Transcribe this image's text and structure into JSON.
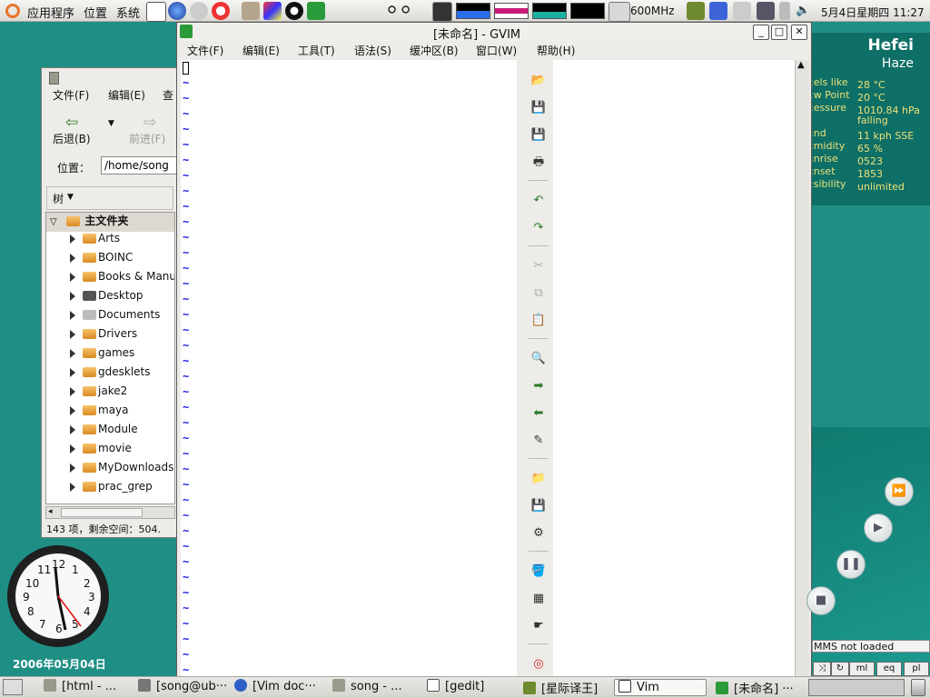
{
  "top_panel": {
    "menus": [
      "应用程序",
      "位置",
      "系统"
    ],
    "cpu": "600MHz",
    "clock": "5月4日星期四 11:27"
  },
  "weather": {
    "city": "Hefei",
    "condition": "Haze",
    "rows": [
      {
        "key": "els like:",
        "value": "28 °C"
      },
      {
        "key": "w Point:",
        "value": "20 °C"
      },
      {
        "key": "essure:",
        "value": "1010.84 hPa"
      },
      {
        "key": "",
        "value": "falling"
      },
      {
        "key": "nd:",
        "value": "11 kph SSE"
      },
      {
        "key": "midity:",
        "value": "65 %"
      },
      {
        "key": "nrise:",
        "value": "0523"
      },
      {
        "key": "nset:",
        "value": "1853"
      },
      {
        "key": "sibility:",
        "value": "unlimited"
      }
    ]
  },
  "clock_widget": {
    "numbers": [
      "12",
      "1",
      "2",
      "3",
      "4",
      "5",
      "6",
      "7",
      "8",
      "9",
      "10",
      "11"
    ],
    "date": "2006年05月04日"
  },
  "nautilus": {
    "menu": [
      "文件(F)",
      "编辑(E)",
      "查"
    ],
    "back_label": "后退(B)",
    "forward_label": "前进(F)",
    "location_label": "位置：",
    "location_value": "/home/song",
    "view_mode": "树",
    "root": "主文件夹",
    "folders": [
      "Arts",
      "BOINC",
      "Books & Manuals",
      "Desktop",
      "Documents",
      "Drivers",
      "games",
      "gdesklets",
      "jake2",
      "maya",
      "Module",
      "movie",
      "MyDownloads",
      "prac_grep"
    ],
    "status": "143 项，剩余空间：504."
  },
  "gvim": {
    "title": "[未命名] - GVIM",
    "menu": [
      "文件(F)",
      "编辑(E)",
      "工具(T)",
      "语法(S)",
      "缓冲区(B)",
      "窗口(W)",
      "帮助(H)"
    ],
    "tilde": "~"
  },
  "media": {
    "status": "MMS not loaded",
    "buttons": [
      "ml",
      "eq",
      "pl"
    ]
  },
  "taskbar": {
    "tasks": [
      "[html - ...",
      "[song@ub···",
      "[Vim doc···",
      "song - ...",
      "[gedit]",
      "[星际译王]",
      "Vim",
      "[未命名] ···"
    ]
  }
}
